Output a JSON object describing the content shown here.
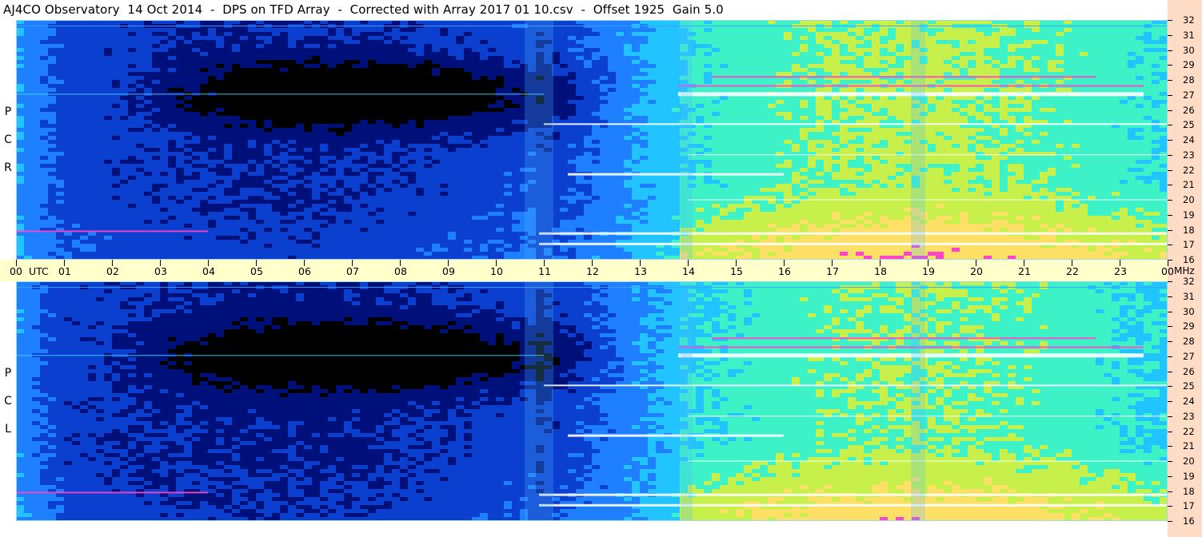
{
  "title": "AJ4CO Observatory  14 Oct 2014  -  DPS on TFD Array  -  Corrected with Array 2017 01 10.csv  -  Offset 1925  Gain 5.0",
  "chart_data": {
    "type": "heatmap",
    "title": "AJ4CO Observatory  14 Oct 2014  -  DPS on TFD Array  -  Corrected with Array 2017 01 10.csv  -  Offset 1925  Gain 5.0",
    "x_axis": {
      "unit_label": "UTC",
      "range": [
        0,
        24
      ],
      "ticks": [
        "00",
        "01",
        "02",
        "03",
        "04",
        "05",
        "06",
        "07",
        "08",
        "09",
        "10",
        "11",
        "12",
        "13",
        "14",
        "15",
        "16",
        "17",
        "18",
        "19",
        "20",
        "21",
        "22",
        "23",
        "00"
      ]
    },
    "y_axis": {
      "unit_label": "MHz",
      "range": [
        16,
        32
      ],
      "ticks": [
        "32",
        "31",
        "30",
        "29",
        "28",
        "27",
        "26",
        "25",
        "24",
        "23",
        "22",
        "21",
        "20",
        "19",
        "18",
        "17",
        "16"
      ]
    },
    "panels": [
      {
        "label_letters": [
          "P",
          "C",
          "R"
        ]
      },
      {
        "label_letters": [
          "P",
          "C",
          "L"
        ]
      }
    ],
    "colormap": [
      "#000000",
      "#00107a",
      "#0a3fcf",
      "#1e7fff",
      "#22c4ff",
      "#3ef2c8",
      "#c7f04a",
      "#ffe066",
      "#ff44c8",
      "#ffffff"
    ],
    "frame_color": "#9fd8e8",
    "axis_band_color": "#ffffcc",
    "freq_band_color": "#ffdcc6"
  }
}
